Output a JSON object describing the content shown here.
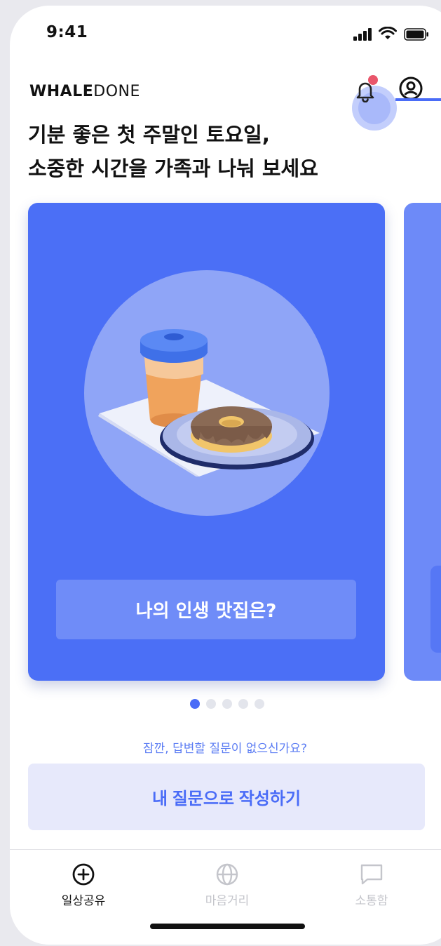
{
  "status_bar": {
    "time": "9:41"
  },
  "header": {
    "logo_bold": "WHALE",
    "logo_light": "DONE",
    "greeting_line1": "기분 좋은 첫 주말인 토요일,",
    "greeting_line2": "소중한 시간을 가족과 나눠 보세요"
  },
  "card": {
    "question": "나의 인생 맛집은?",
    "background_color": "#4b6ff6"
  },
  "pagination": {
    "total": 5,
    "active_index": 0
  },
  "prompt": {
    "hint": "잠깐, 답변할 질문이 없으신가요?",
    "write_button": "내 질문으로 작성하기"
  },
  "bottom_nav": {
    "items": [
      {
        "label": "일상공유",
        "icon": "plus-circle-icon",
        "active": true
      },
      {
        "label": "마음거리",
        "icon": "globe-icon",
        "active": false
      },
      {
        "label": "소통함",
        "icon": "chat-bubble-icon",
        "active": false
      }
    ]
  },
  "colors": {
    "accent": "#4a6cf7",
    "notification_dot": "#e9566b"
  }
}
